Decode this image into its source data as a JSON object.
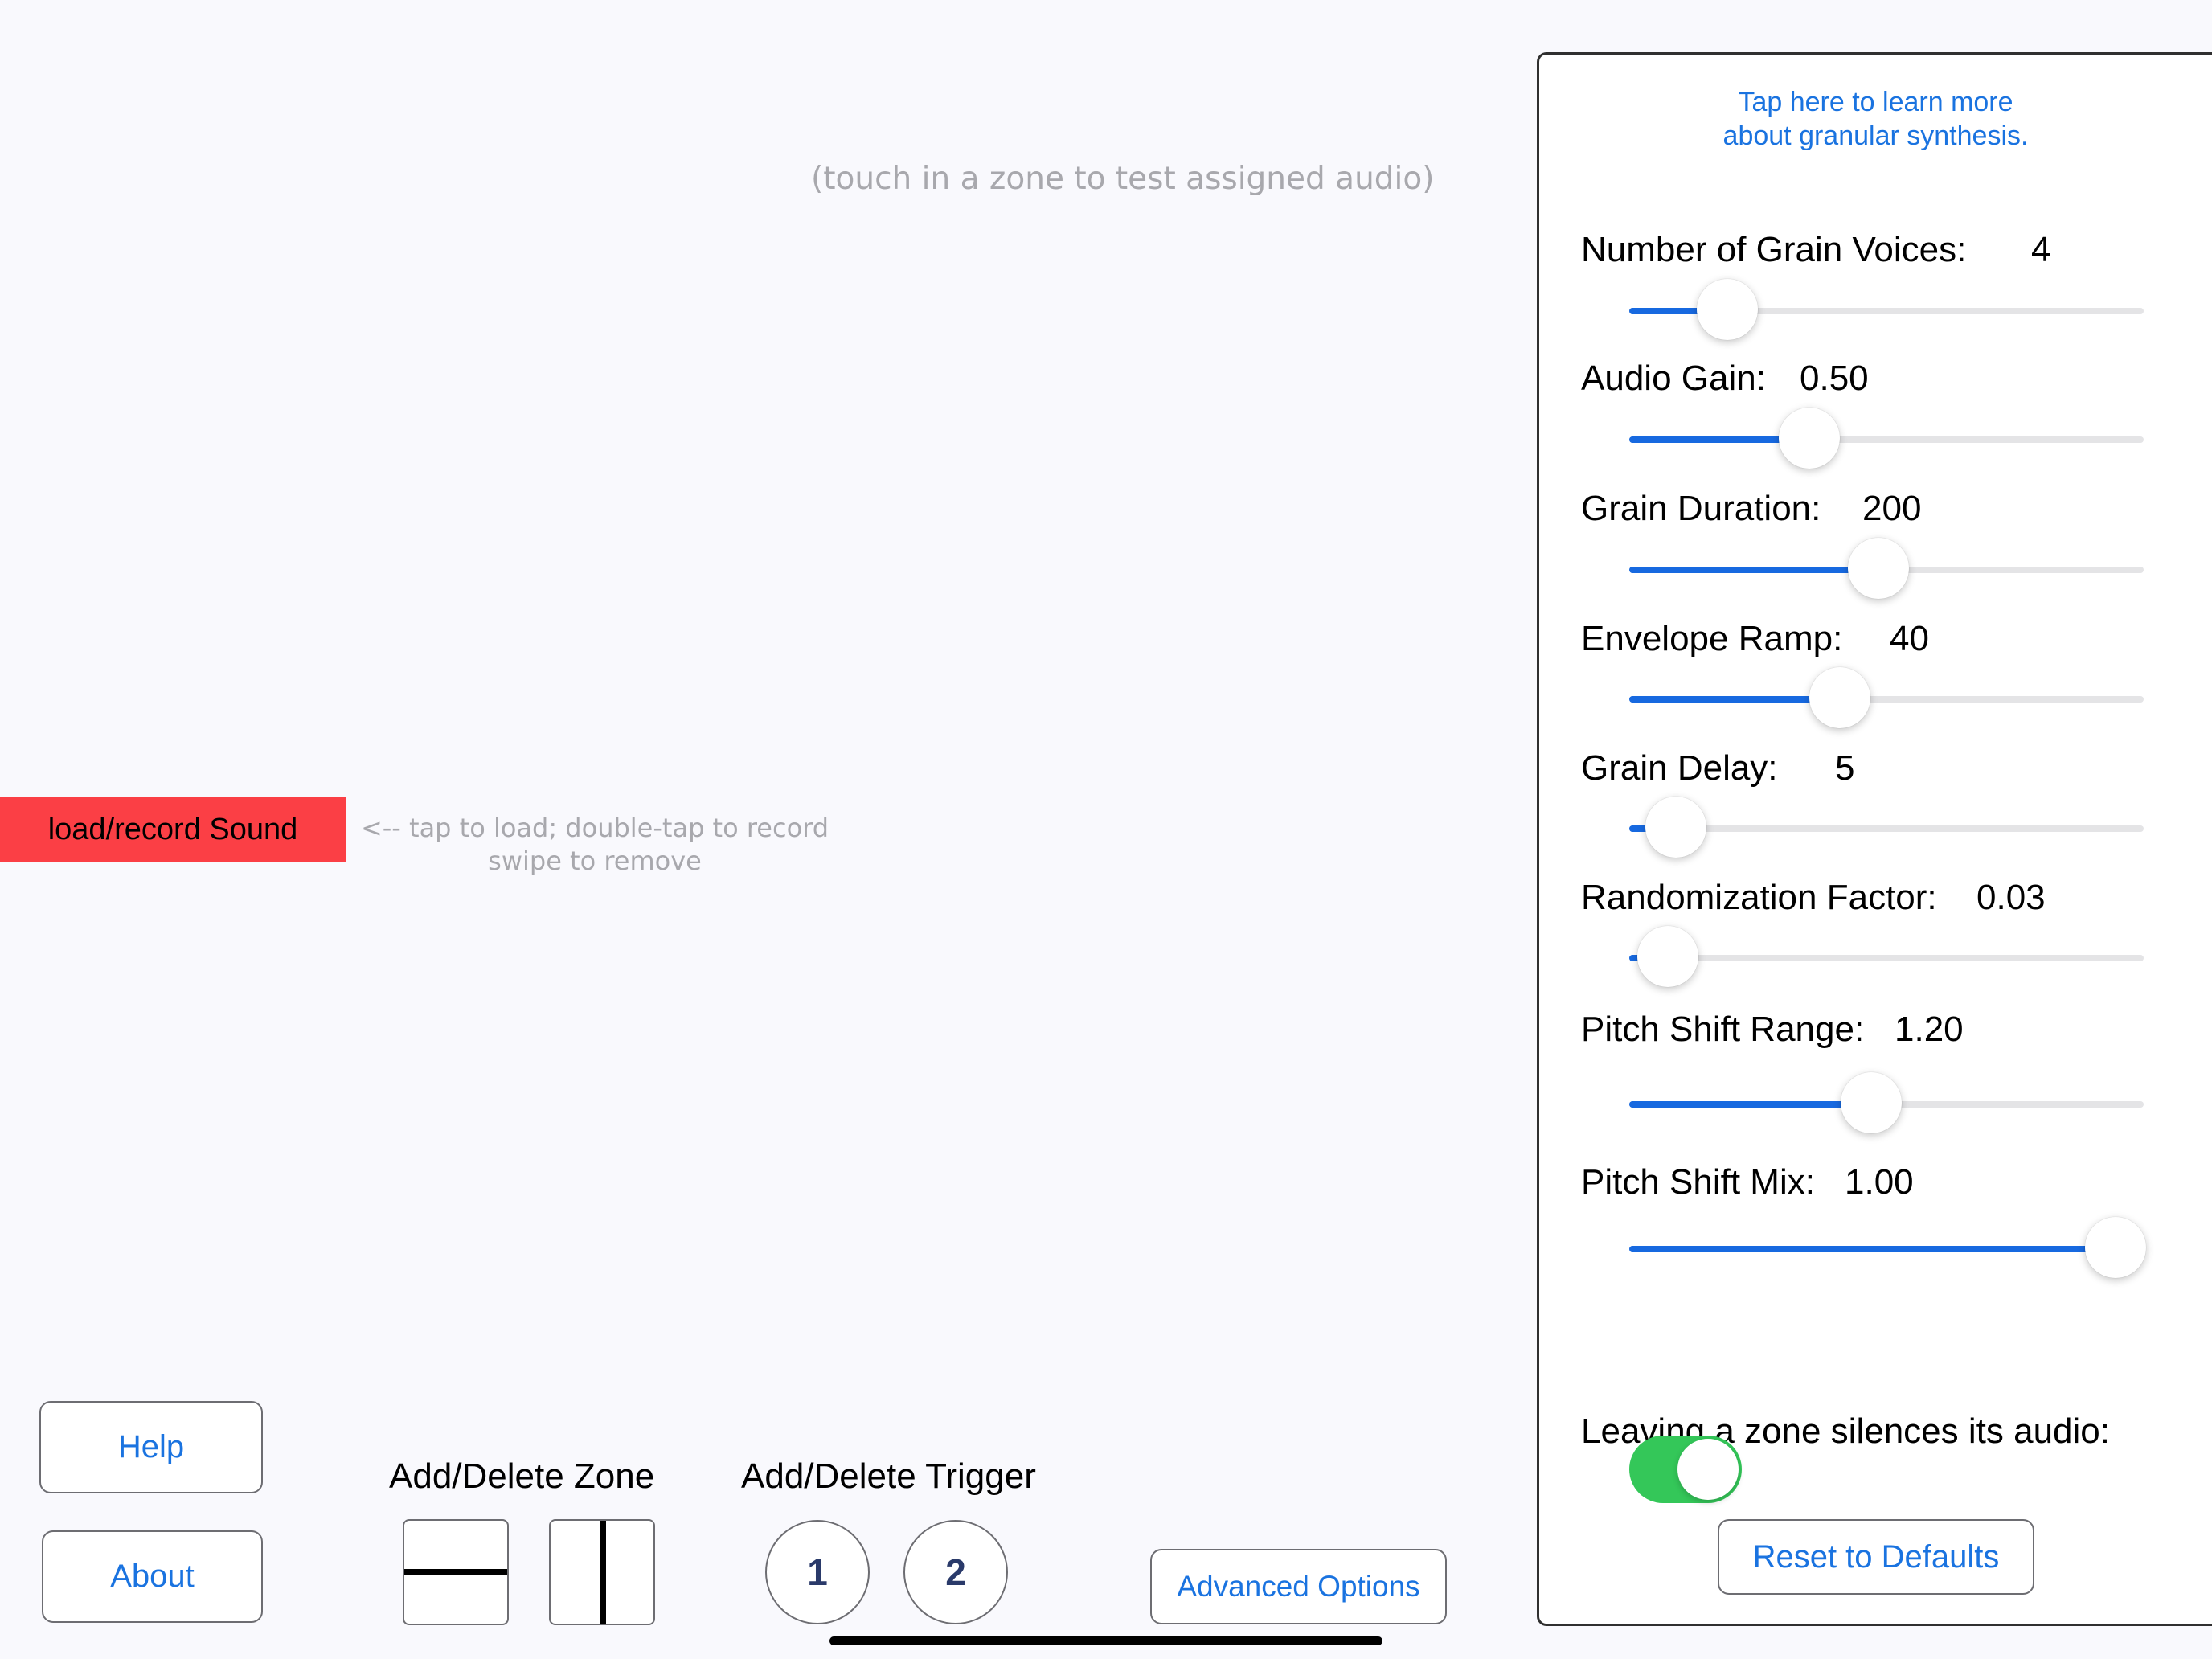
{
  "main": {
    "test_hint": "(touch in a zone to test assigned audio)",
    "load_button": "load/record Sound",
    "load_hint_line1": "<-- tap to load; double-tap to record",
    "load_hint_line2": "swipe to remove",
    "help_button": "Help",
    "about_button": "About",
    "zone_label": "Add/Delete Zone",
    "trigger_label": "Add/Delete Trigger",
    "trigger_1": "1",
    "trigger_2": "2",
    "advanced_button": "Advanced Options"
  },
  "panel": {
    "learn_line1": "Tap here to learn more",
    "learn_line2": "about granular synthesis.",
    "params": [
      {
        "label": "Number of Grain Voices:",
        "value": "4",
        "level": 0.19
      },
      {
        "label": "Audio Gain:",
        "value": "0.50",
        "level": 0.35
      },
      {
        "label": "Grain Duration:",
        "value": "200",
        "level": 0.485
      },
      {
        "label": "Envelope Ramp:",
        "value": "40",
        "level": 0.41
      },
      {
        "label": "Grain Delay:",
        "value": "5",
        "level": 0.09
      },
      {
        "label": "Randomization Factor:",
        "value": "0.03",
        "level": 0.075
      },
      {
        "label": "Pitch Shift Range:",
        "value": "1.20",
        "level": 0.47
      },
      {
        "label": "Pitch Shift Mix:",
        "value": "1.00",
        "level": 0.945
      }
    ],
    "toggle_label": "Leaving a zone silences its audio:",
    "toggle_on": true,
    "reset_button": "Reset to Defaults"
  },
  "colors": {
    "accent": "#1769e0",
    "load_button": "#fb3f45",
    "toggle_on": "#34c759"
  }
}
